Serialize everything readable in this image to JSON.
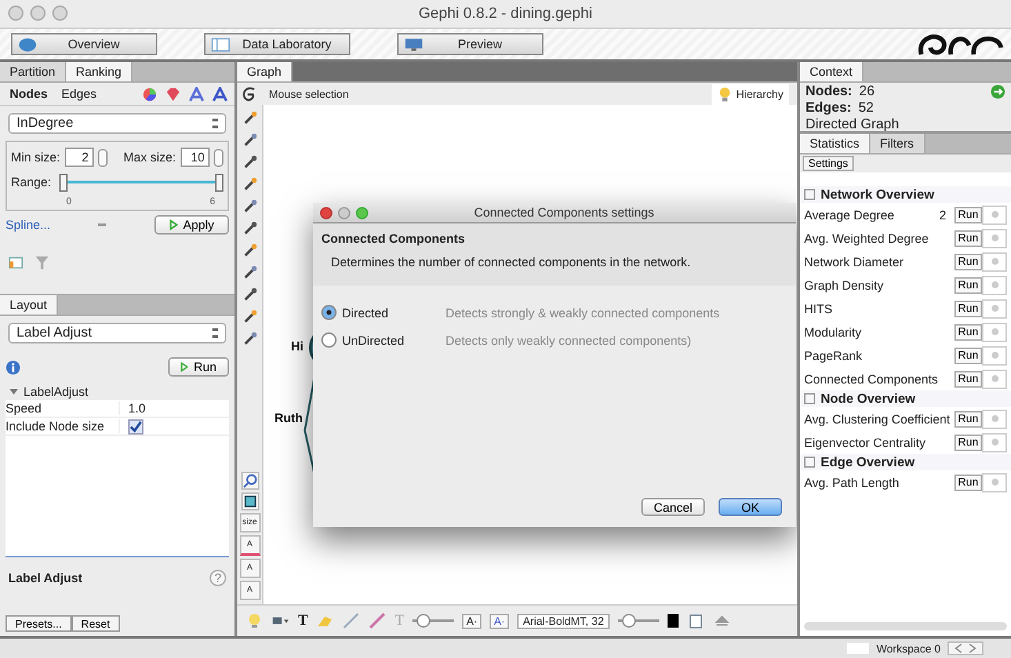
{
  "window": {
    "title": "Gephi 0.8.2 - dining.gephi"
  },
  "perspectives": [
    {
      "label": "Overview",
      "kind": "globe"
    },
    {
      "label": "Data Laboratory",
      "kind": "table"
    },
    {
      "label": "Preview",
      "kind": "screen"
    }
  ],
  "ranking_panel": {
    "tabs": [
      {
        "label": "Partition",
        "selected": false
      },
      {
        "label": "Ranking",
        "selected": true
      }
    ],
    "subtabs": [
      {
        "label": "Nodes",
        "selected": true
      },
      {
        "label": "Edges",
        "selected": false
      }
    ],
    "attribute": "InDegree",
    "min_label": "Min size:",
    "min_value": "2",
    "max_label": "Max size:",
    "max_value": "10",
    "range_label": "Range:",
    "range_slider": {
      "level": 1
    },
    "range_min": "0",
    "range_max": "6",
    "spline_link": "Spline...",
    "apply_button": "Apply"
  },
  "layout_panel": {
    "tab": "Layout",
    "algorithm": "Label Adjust",
    "run_button": "Run",
    "group": "LabelAdjust",
    "properties": [
      {
        "name": "Speed",
        "kind": "text",
        "value": "1.0"
      },
      {
        "name": "Include Node size",
        "kind": "checkbox",
        "checked": true
      }
    ],
    "description_title": "Label Adjust",
    "help": "?",
    "buttons": [
      "Presets...",
      "Reset"
    ]
  },
  "graph_panel": {
    "tab": "Graph",
    "mode": "Mouse selection",
    "hierarchy": "Hierarchy",
    "node_labels": [
      "Hi",
      "Ruth"
    ],
    "edge_scale_slider": {
      "level": 0.15
    },
    "label_size_slider": {
      "level": 0.15
    },
    "palette_labels": [
      "size",
      "A",
      "A",
      "A"
    ],
    "text_tools": [
      "T",
      "T"
    ],
    "font_color_buttons": [
      "A·",
      "A·"
    ],
    "font": "Arial-BoldMT, 32"
  },
  "dialog": {
    "title": "Connected Components settings",
    "heading": "Connected Components",
    "description": "Determines the number of connected components in the network.",
    "options": [
      {
        "label": "Directed",
        "hint": "Detects strongly & weakly connected components",
        "selected": true
      },
      {
        "label": "UnDirected",
        "hint": "Detects only weakly connected components)",
        "selected": false
      }
    ],
    "buttons": [
      {
        "label": "Cancel",
        "kind": "normal"
      },
      {
        "label": "OK",
        "kind": "default"
      }
    ]
  },
  "context_panel": {
    "tab": "Context",
    "nodes_label": "Nodes:",
    "nodes": "26",
    "edges_label": "Edges:",
    "edges": "52",
    "graph_type": "Directed Graph"
  },
  "statistics_panel": {
    "tabs": [
      {
        "label": "Statistics",
        "selected": true
      },
      {
        "label": "Filters",
        "selected": false
      }
    ],
    "settings_button": "Settings",
    "groups": [
      {
        "title": "Network Overview",
        "items": [
          {
            "name": "Average Degree",
            "value": "2",
            "button": "Run"
          },
          {
            "name": "Avg. Weighted Degree",
            "button": "Run"
          },
          {
            "name": "Network Diameter",
            "button": "Run"
          },
          {
            "name": "Graph Density",
            "button": "Run"
          },
          {
            "name": "HITS",
            "button": "Run"
          },
          {
            "name": "Modularity",
            "button": "Run"
          },
          {
            "name": "PageRank",
            "button": "Run"
          },
          {
            "name": "Connected Components",
            "button": "Run"
          }
        ]
      },
      {
        "title": "Node Overview",
        "items": [
          {
            "name": "Avg. Clustering Coefficient",
            "button": "Run"
          },
          {
            "name": "Eigenvector Centrality",
            "button": "Run"
          }
        ]
      },
      {
        "title": "Edge Overview",
        "items": [
          {
            "name": "Avg. Path Length",
            "button": "Run"
          }
        ]
      }
    ]
  },
  "status_bar": {
    "workspace": "Workspace 0"
  }
}
